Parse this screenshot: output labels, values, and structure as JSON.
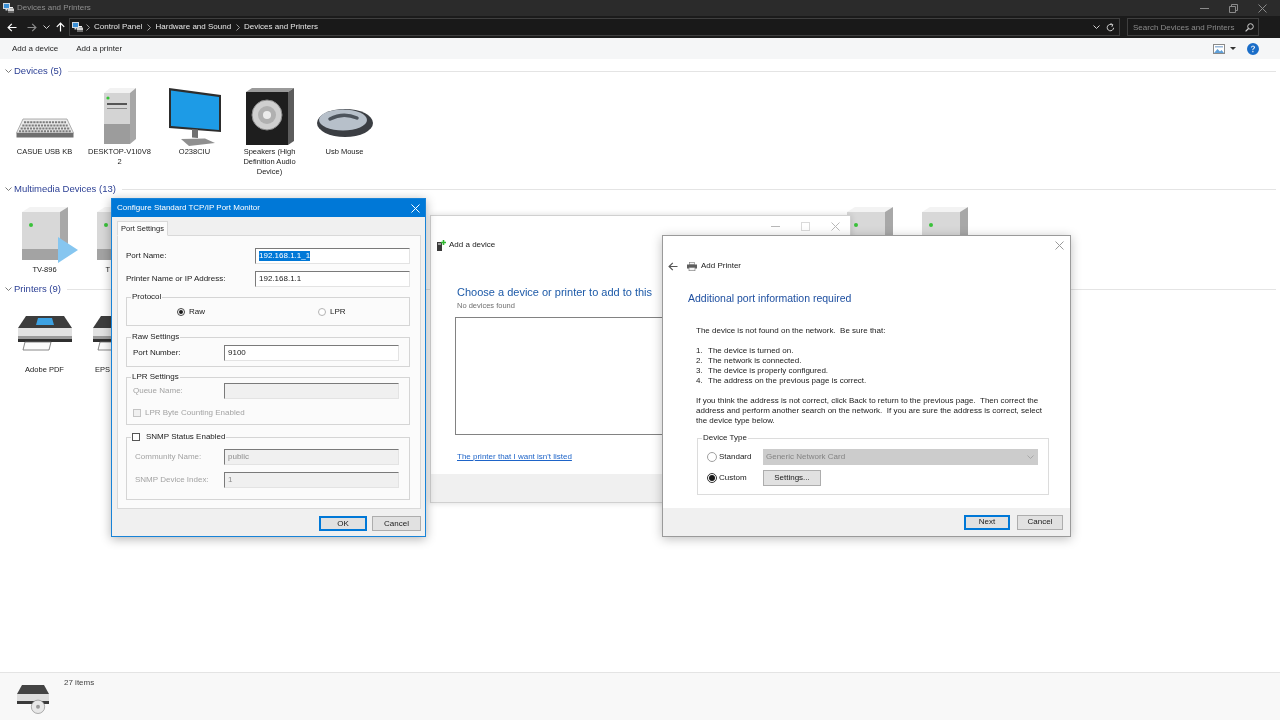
{
  "window": {
    "title": "Devices and Printers"
  },
  "navigation": {
    "breadcrumbs": [
      "Control Panel",
      "Hardware and Sound",
      "Devices and Printers"
    ],
    "search": {
      "placeholder": "Search Devices and Printers"
    }
  },
  "command_bar": {
    "actions": [
      "Add a device",
      "Add a printer"
    ]
  },
  "groups": [
    {
      "title": "Devices (5)",
      "expanded": true,
      "items": [
        {
          "kind": "keyboard",
          "label": "CASUE USB KB"
        },
        {
          "kind": "computer",
          "label": "DESKTOP-V1I0V82"
        },
        {
          "kind": "monitor",
          "label": "O238CIU"
        },
        {
          "kind": "speaker",
          "label": "Speakers (High Definition Audio Device)"
        },
        {
          "kind": "mouse",
          "label": "Usb Mouse"
        }
      ]
    },
    {
      "title": "Multimedia Devices (13)",
      "expanded": true,
      "items": [
        {
          "kind": "media_player",
          "label": "TV-896"
        },
        {
          "kind": "media_server",
          "label": "T"
        },
        {
          "kind": "media_server"
        },
        {
          "kind": "media_server"
        }
      ]
    },
    {
      "title": "Printers (9)",
      "expanded": true,
      "items": [
        {
          "kind": "printer",
          "label": "Adobe PDF"
        },
        {
          "kind": "printer",
          "label": "EPS"
        }
      ]
    }
  ],
  "status_bar": {
    "item_count": "27 items"
  },
  "add_device_window": {
    "title": "Add a device",
    "heading": "Choose a device or printer to add to this",
    "status": "No devices found",
    "link": "The printer that I want isn't listed"
  },
  "add_printer_dialog": {
    "title": "Add Printer",
    "heading": "Additional port information required",
    "intro": "The device is not found on the network.  Be sure that:",
    "checklist": [
      {
        "number": "1.",
        "text": "The device is turned on."
      },
      {
        "number": "2.",
        "text": "The network is connected."
      },
      {
        "number": "3.",
        "text": "The device is properly configured."
      },
      {
        "number": "4.",
        "text": "The address on the previous page is correct."
      }
    ],
    "paragraph": "If you think the address is not correct, click Back to return to the previous page.  Then correct the address and perform another search on the network.  If you are sure the address is correct, select the device type below.",
    "device_type": {
      "title": "Device Type",
      "options": [
        {
          "label": "Standard",
          "selected": false
        },
        {
          "label": "Custom",
          "selected": true
        }
      ],
      "dropdown": {
        "value": "Generic Network Card",
        "disabled": true
      },
      "settings_button": "Settings..."
    },
    "buttons": [
      {
        "label": "Next",
        "default": true
      },
      {
        "label": "Cancel",
        "default": false
      }
    ]
  },
  "port_monitor_dialog": {
    "title": "Configure Standard TCP/IP Port Monitor",
    "tabs": [
      {
        "label": "Port Settings",
        "selected": true
      }
    ],
    "fields": [
      {
        "label": "Port Name:",
        "value": "192.168.1.1_1",
        "highlighted": true
      },
      {
        "label": "Printer Name or IP Address:",
        "value": "192.168.1.1",
        "highlighted": false
      }
    ],
    "protocol": {
      "title": "Protocol",
      "options": [
        {
          "label": "Raw",
          "selected": true
        },
        {
          "label": "LPR",
          "selected": false
        }
      ]
    },
    "raw_settings": {
      "title": "Raw Settings",
      "fields": [
        {
          "label": "Port Number:",
          "value": "9100",
          "disabled": false
        }
      ]
    },
    "lpr_settings": {
      "title": "LPR Settings",
      "fields": [
        {
          "label": "Queue Name:",
          "disabled": true
        }
      ],
      "options": [
        {
          "label": "LPR Byte Counting Enabled",
          "checked": false,
          "disabled": true
        }
      ]
    },
    "snmp_settings": {
      "toggle": {
        "label": "SNMP Status Enabled",
        "checked": false,
        "disabled": false
      },
      "fields": [
        {
          "label": "Community Name:",
          "value": "public",
          "disabled": true
        },
        {
          "label": "SNMP Device Index:",
          "value": "1",
          "disabled": true
        }
      ]
    },
    "buttons": [
      {
        "label": "OK",
        "default": true
      },
      {
        "label": "Cancel",
        "default": false
      }
    ]
  }
}
